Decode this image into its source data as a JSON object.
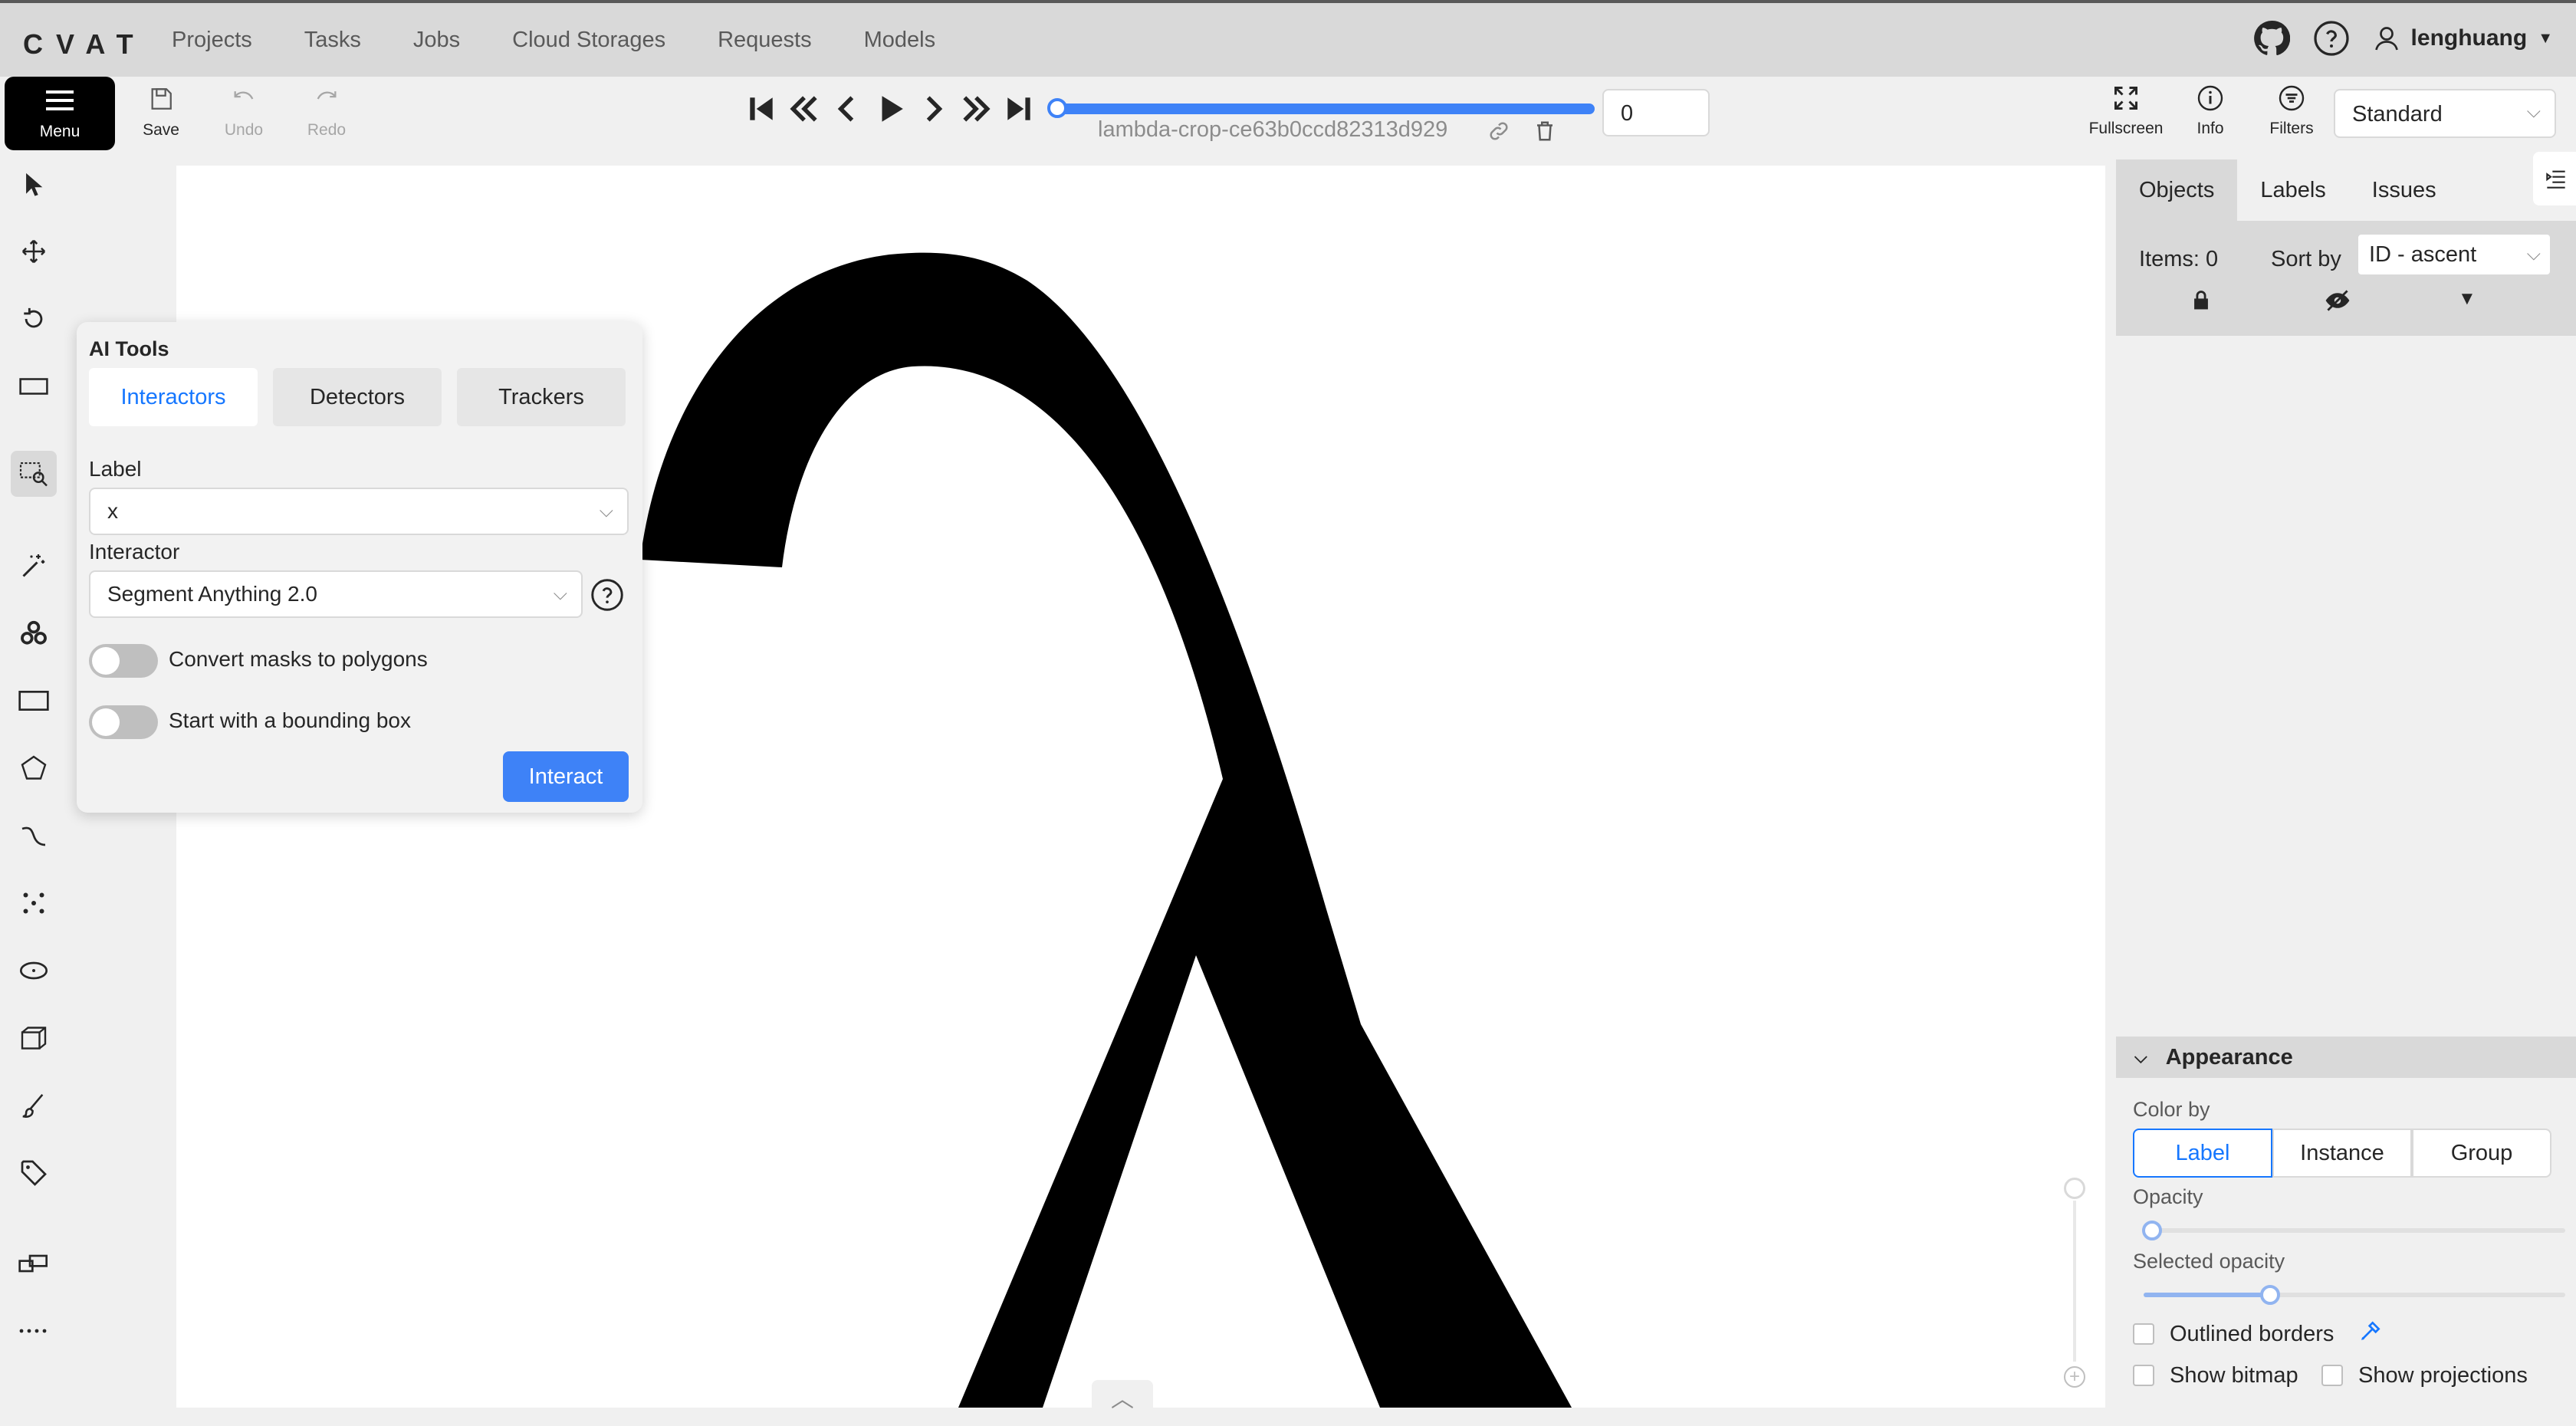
{
  "header": {
    "logo": "CVAT",
    "nav": [
      "Projects",
      "Tasks",
      "Jobs",
      "Cloud Storages",
      "Requests",
      "Models"
    ],
    "username": "lenghuang"
  },
  "toolbar": {
    "menu_label": "Menu",
    "save_label": "Save",
    "undo_label": "Undo",
    "redo_label": "Redo",
    "filename": "lambda-crop-ce63b0ccd82313d929",
    "frame_value": "0",
    "fullscreen_label": "Fullscreen",
    "info_label": "Info",
    "filters_label": "Filters",
    "workspace_value": "Standard"
  },
  "ai_tools": {
    "title": "AI Tools",
    "tabs": [
      "Interactors",
      "Detectors",
      "Trackers"
    ],
    "label_caption": "Label",
    "label_value": "x",
    "interactor_caption": "Interactor",
    "interactor_value": "Segment Anything 2.0",
    "toggle_polygons": "Convert masks to polygons",
    "toggle_bbox": "Start with a bounding box",
    "interact_label": "Interact"
  },
  "right_panel": {
    "tabs": [
      "Objects",
      "Labels",
      "Issues"
    ],
    "items_label": "Items: 0",
    "sort_label": "Sort by",
    "sort_value": "ID - ascent"
  },
  "appearance": {
    "title": "Appearance",
    "color_by_label": "Color by",
    "color_by_options": [
      "Label",
      "Instance",
      "Group"
    ],
    "opacity_label": "Opacity",
    "opacity_value": 0.02,
    "selected_opacity_label": "Selected opacity",
    "selected_opacity_value": 0.3,
    "outlined_borders_label": "Outlined borders",
    "show_bitmap_label": "Show bitmap",
    "show_projections_label": "Show projections"
  },
  "colors": {
    "accent": "#3e82f7",
    "active_tab": "#1677ff"
  }
}
